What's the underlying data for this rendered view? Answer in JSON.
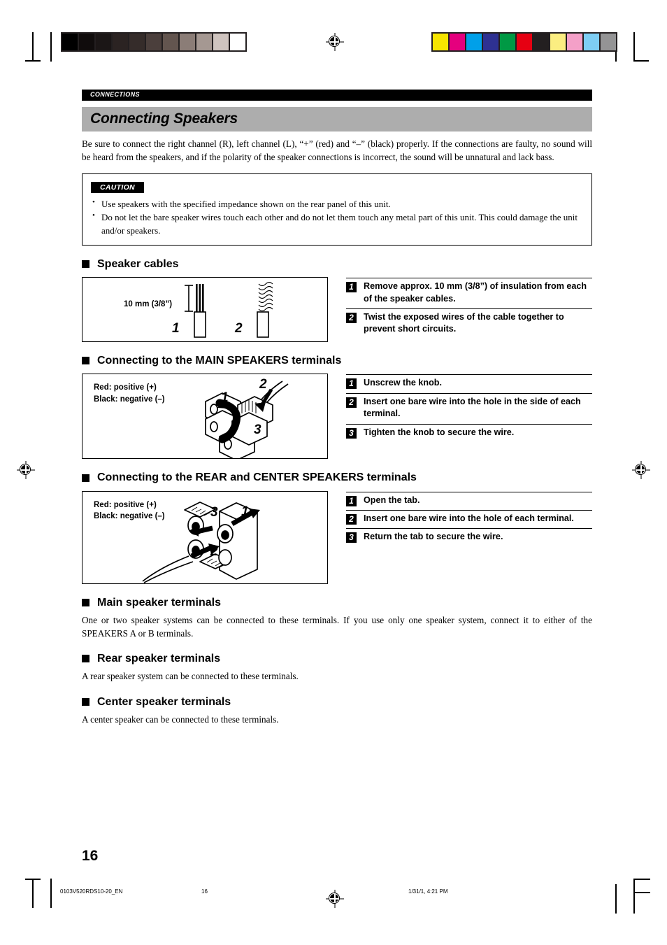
{
  "print_marks": {
    "grey_bar_swatches": [
      "#000000",
      "#100c0c",
      "#1b1616",
      "#2b2322",
      "#352c2a",
      "#4b3f3c",
      "#63554f",
      "#8b7d77",
      "#a59892",
      "#cfc4bf",
      "#ffffff"
    ],
    "color_bar_swatches": [
      "#f6e500",
      "#e5007e",
      "#00a0e9",
      "#2e3192",
      "#009944",
      "#e60012",
      "#231f20",
      "#fbee81",
      "#f4a0c8",
      "#7ecef4",
      "#949495"
    ]
  },
  "header": {
    "section_label": "CONNECTIONS",
    "chapter_title": "Connecting Speakers"
  },
  "intro": {
    "paragraph": "Be sure to connect the right channel (R), left channel (L), “+” (red) and “–” (black) properly. If the connections are faulty, no sound will be heard from the speakers, and if the polarity of the speaker connections is incorrect, the sound will be unnatural and lack bass."
  },
  "caution": {
    "label": "CAUTION",
    "items": [
      "Use speakers with the specified impedance shown on the rear panel of this unit.",
      "Do not let the bare speaker wires touch each other and do not let them touch any metal part of this unit. This could damage the unit and/or speakers."
    ]
  },
  "sections": {
    "speaker_cables": {
      "heading": "Speaker cables",
      "figure": {
        "measure_label": "10 mm (3/8”)",
        "callout_1": "1",
        "callout_2": "2"
      },
      "steps": [
        {
          "num": "1",
          "text": "Remove approx. 10 mm (3/8”) of insulation from each of the speaker cables."
        },
        {
          "num": "2",
          "text": "Twist the exposed wires of the cable together to prevent short circuits."
        }
      ]
    },
    "main_speakers": {
      "heading": "Connecting to the MAIN SPEAKERS terminals",
      "figure": {
        "polarity": "Red: positive (+)\nBlack: negative (–)",
        "callouts": [
          "1",
          "2",
          "3"
        ]
      },
      "steps": [
        {
          "num": "1",
          "text": "Unscrew the knob."
        },
        {
          "num": "2",
          "text": "Insert one bare wire into the hole in the side of each terminal."
        },
        {
          "num": "3",
          "text": "Tighten the knob to secure the wire."
        }
      ]
    },
    "rear_center_speakers": {
      "heading": "Connecting to the REAR and CENTER SPEAKERS terminals",
      "figure": {
        "polarity": "Red: positive (+)\nBlack: negative (–)",
        "callouts": [
          "1",
          "2",
          "3"
        ]
      },
      "steps": [
        {
          "num": "1",
          "text": "Open the tab."
        },
        {
          "num": "2",
          "text": "Insert one bare wire into the hole of each terminal."
        },
        {
          "num": "3",
          "text": "Return the tab to secure the wire."
        }
      ]
    },
    "main_terminals": {
      "heading": "Main speaker terminals",
      "body": "One or two speaker systems can be connected to these terminals. If you use only one speaker system, connect it to either of the SPEAKERS A or B terminals."
    },
    "rear_terminals": {
      "heading": "Rear speaker terminals",
      "body": "A rear speaker system can be connected to these terminals."
    },
    "center_terminals": {
      "heading": "Center speaker terminals",
      "body": "A center speaker can be connected to these terminals."
    }
  },
  "footer": {
    "page_number": "16",
    "file_name": "0103V520RDS10-20_EN",
    "sheet_number": "16",
    "timestamp": "1/31/1, 4:21 PM"
  }
}
